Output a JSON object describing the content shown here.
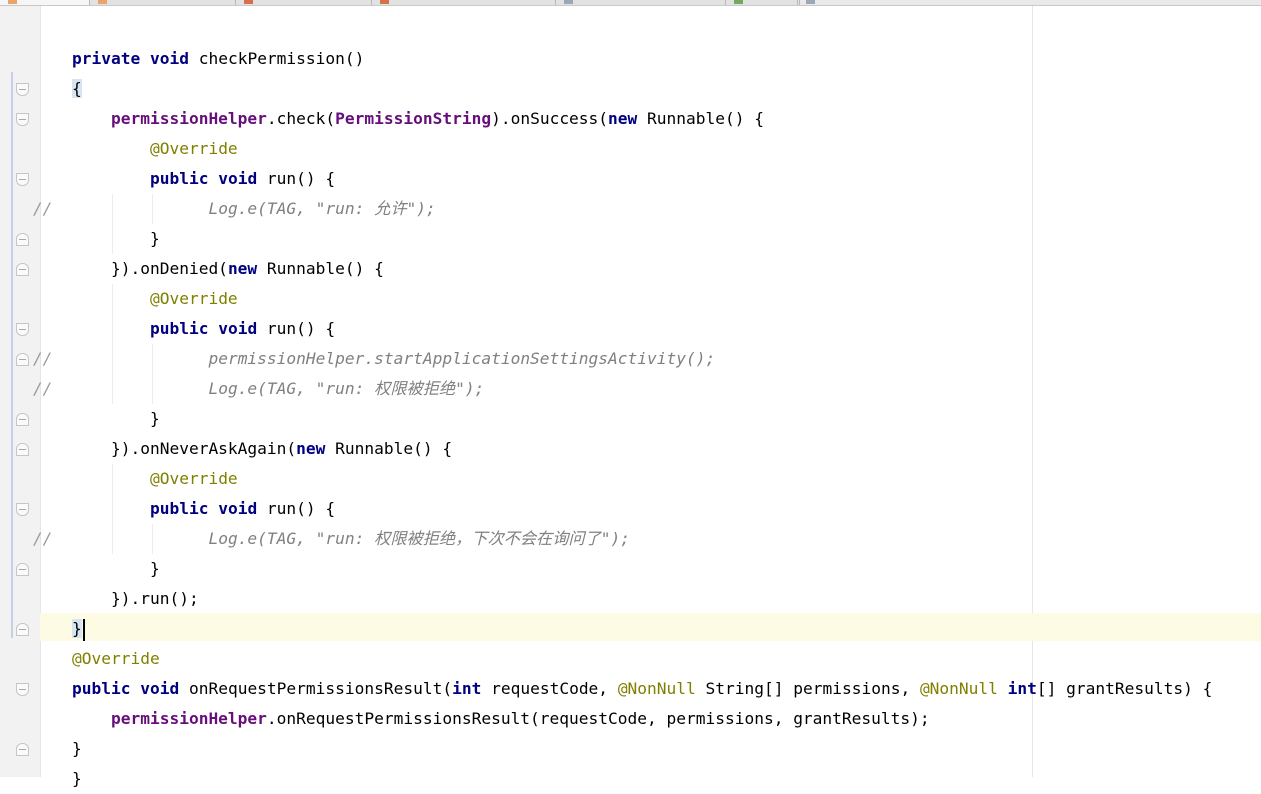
{
  "editor": {
    "lines": [
      {
        "segments": [
          {
            "t": "private",
            "c": "kw"
          },
          {
            "t": " "
          },
          {
            "t": "void",
            "c": "kw"
          },
          {
            "t": " checkPermission()"
          }
        ]
      },
      {
        "segments": [
          {
            "t": "{",
            "c": "brace-hl"
          }
        ]
      },
      {
        "segments": [
          {
            "t": "    "
          },
          {
            "t": "permissionHelper",
            "c": "field"
          },
          {
            "t": ".check("
          },
          {
            "t": "PermissionString",
            "c": "field"
          },
          {
            "t": ").onSuccess("
          },
          {
            "t": "new",
            "c": "kw"
          },
          {
            "t": " Runnable() {"
          }
        ]
      },
      {
        "segments": [
          {
            "t": "        "
          },
          {
            "t": "@Override",
            "c": "anno"
          }
        ]
      },
      {
        "segments": [
          {
            "t": "        "
          },
          {
            "t": "public",
            "c": "kw"
          },
          {
            "t": " "
          },
          {
            "t": "void",
            "c": "kw"
          },
          {
            "t": " run() {"
          }
        ]
      },
      {
        "segments": [
          {
            "t": "              "
          },
          {
            "t": "Log.e(TAG, \"run: 允许\");",
            "c": "cm"
          }
        ]
      },
      {
        "segments": [
          {
            "t": "        }"
          }
        ]
      },
      {
        "segments": [
          {
            "t": "    }).onDenied("
          },
          {
            "t": "new",
            "c": "kw"
          },
          {
            "t": " Runnable() {"
          }
        ]
      },
      {
        "segments": [
          {
            "t": "        "
          },
          {
            "t": "@Override",
            "c": "anno"
          }
        ]
      },
      {
        "segments": [
          {
            "t": "        "
          },
          {
            "t": "public",
            "c": "kw"
          },
          {
            "t": " "
          },
          {
            "t": "void",
            "c": "kw"
          },
          {
            "t": " run() {"
          }
        ]
      },
      {
        "segments": [
          {
            "t": "              "
          },
          {
            "t": "permissionHelper.startApplicationSettingsActivity();",
            "c": "cm"
          }
        ]
      },
      {
        "segments": [
          {
            "t": "              "
          },
          {
            "t": "Log.e(TAG, \"run: 权限被拒绝\");",
            "c": "cm"
          }
        ]
      },
      {
        "segments": [
          {
            "t": "        }"
          }
        ]
      },
      {
        "segments": [
          {
            "t": "    }).onNeverAskAgain("
          },
          {
            "t": "new",
            "c": "kw"
          },
          {
            "t": " Runnable() {"
          }
        ]
      },
      {
        "segments": [
          {
            "t": "        "
          },
          {
            "t": "@Override",
            "c": "anno"
          }
        ]
      },
      {
        "segments": [
          {
            "t": "        "
          },
          {
            "t": "public",
            "c": "kw"
          },
          {
            "t": " "
          },
          {
            "t": "void",
            "c": "kw"
          },
          {
            "t": " run() {"
          }
        ]
      },
      {
        "segments": [
          {
            "t": "              "
          },
          {
            "t": "Log.e(TAG, \"run: 权限被拒绝，下次不会在询问了\");",
            "c": "cm"
          }
        ]
      },
      {
        "segments": [
          {
            "t": "        }"
          }
        ]
      },
      {
        "segments": [
          {
            "t": "    }).run();"
          }
        ]
      },
      {
        "segments": [
          {
            "t": "}",
            "c": "caret-brace"
          }
        ]
      },
      {
        "segments": [
          {
            "t": "@Override",
            "c": "anno"
          }
        ]
      },
      {
        "segments": [
          {
            "t": "public",
            "c": "kw"
          },
          {
            "t": " "
          },
          {
            "t": "void",
            "c": "kw"
          },
          {
            "t": " onRequestPermissionsResult("
          },
          {
            "t": "int",
            "c": "kw"
          },
          {
            "t": " requestCode, "
          },
          {
            "t": "@NonNull",
            "c": "anno"
          },
          {
            "t": " String[] permissions, "
          },
          {
            "t": "@NonNull",
            "c": "anno"
          },
          {
            "t": " "
          },
          {
            "t": "int",
            "c": "kw"
          },
          {
            "t": "[] grantResults) {"
          }
        ]
      },
      {
        "segments": [
          {
            "t": "    "
          },
          {
            "t": "permissionHelper",
            "c": "field"
          },
          {
            "t": ".onRequestPermissionsResult(requestCode, permissions, grantResults);"
          }
        ]
      },
      {
        "segments": [
          {
            "t": "}"
          }
        ]
      },
      {
        "segments": [
          {
            "t": "}"
          }
        ]
      }
    ],
    "line_comment_marker": "//",
    "commented_lines": [
      5,
      10,
      11,
      16
    ],
    "fold_open_lines": [
      1,
      2,
      4,
      9,
      15,
      21
    ],
    "fold_close_lines": [
      6,
      7,
      10,
      12,
      13,
      17,
      19,
      23
    ],
    "current_line": 19
  },
  "tabs": {
    "count": 7,
    "icon_colors": [
      "#e8a46a",
      "#e8a46a",
      "#d6704a",
      "#d6704a",
      "#9aa7b5",
      "#73a95f",
      "#9aa7b5"
    ]
  },
  "colors": {
    "keyword": "#000080",
    "field": "#660e7a",
    "annotation": "#808000",
    "comment": "#808080",
    "caret_row": "#fdfbe4",
    "brace_highlight": "#d7e5f3"
  }
}
